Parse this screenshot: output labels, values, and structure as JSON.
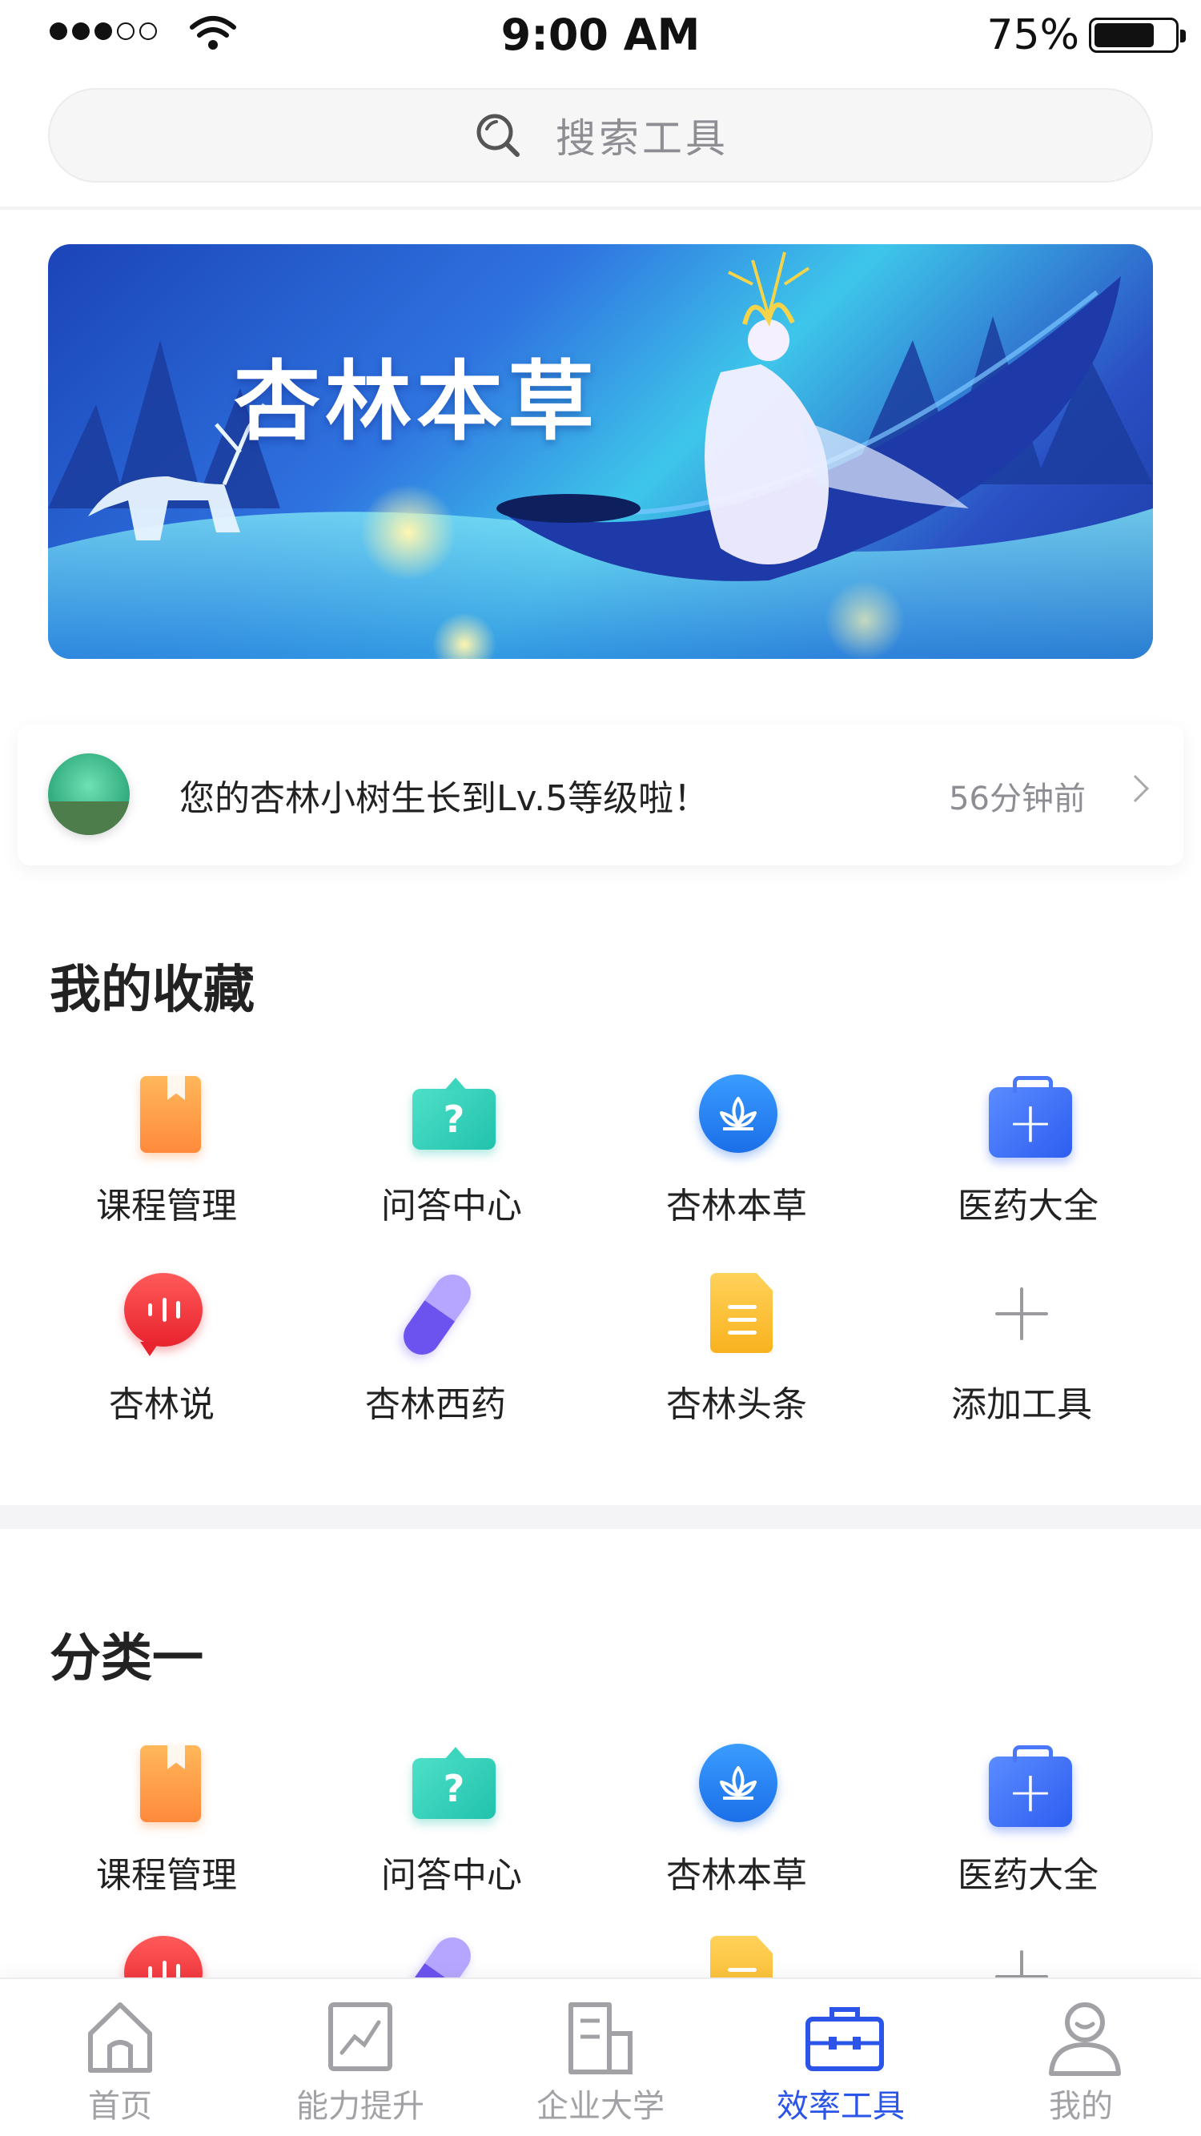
{
  "status_bar": {
    "time": "9:00 AM",
    "battery": "75%"
  },
  "search": {
    "placeholder": "搜索工具"
  },
  "banner": {
    "title": "杏林本草"
  },
  "notice": {
    "message": "您的杏林小树生长到Lv.5等级啦！",
    "time": "56分钟前"
  },
  "favorites": {
    "title": "我的收藏",
    "items": [
      {
        "label": "课程管理",
        "icon": "book-icon"
      },
      {
        "label": "问答中心",
        "icon": "qa-icon"
      },
      {
        "label": "杏林本草",
        "icon": "herb-icon"
      },
      {
        "label": "医药大全",
        "icon": "medkit-icon"
      },
      {
        "label": "杏林说",
        "icon": "speech-icon"
      },
      {
        "label": "杏林西药",
        "icon": "pill-icon"
      },
      {
        "label": "杏林头条",
        "icon": "news-icon"
      },
      {
        "label": "添加工具",
        "icon": "plus-icon"
      }
    ]
  },
  "category1": {
    "title": "分类一",
    "items": [
      {
        "label": "课程管理",
        "icon": "book-icon"
      },
      {
        "label": "问答中心",
        "icon": "qa-icon"
      },
      {
        "label": "杏林本草",
        "icon": "herb-icon"
      },
      {
        "label": "医药大全",
        "icon": "medkit-icon"
      }
    ]
  },
  "tabbar": {
    "items": [
      {
        "label": "首页",
        "icon": "home-icon"
      },
      {
        "label": "能力提升",
        "icon": "chart-icon"
      },
      {
        "label": "企业大学",
        "icon": "building-icon"
      },
      {
        "label": "效率工具",
        "icon": "toolbox-icon",
        "active": true
      },
      {
        "label": "我的",
        "icon": "profile-icon"
      }
    ]
  },
  "colors": {
    "accent": "#2a55e8",
    "text": "#222222",
    "muted": "#8d8d93"
  }
}
